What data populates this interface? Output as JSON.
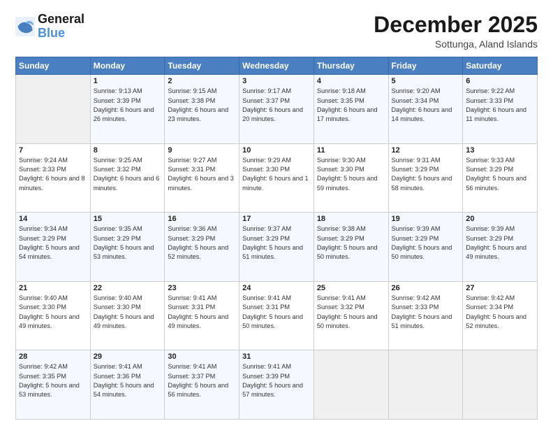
{
  "logo": {
    "line1": "General",
    "line2": "Blue"
  },
  "header": {
    "month": "December 2025",
    "location": "Sottunga, Aland Islands"
  },
  "weekdays": [
    "Sunday",
    "Monday",
    "Tuesday",
    "Wednesday",
    "Thursday",
    "Friday",
    "Saturday"
  ],
  "weeks": [
    [
      {
        "day": "",
        "info": ""
      },
      {
        "day": "1",
        "info": "Sunrise: 9:13 AM\nSunset: 3:39 PM\nDaylight: 6 hours\nand 26 minutes."
      },
      {
        "day": "2",
        "info": "Sunrise: 9:15 AM\nSunset: 3:38 PM\nDaylight: 6 hours\nand 23 minutes."
      },
      {
        "day": "3",
        "info": "Sunrise: 9:17 AM\nSunset: 3:37 PM\nDaylight: 6 hours\nand 20 minutes."
      },
      {
        "day": "4",
        "info": "Sunrise: 9:18 AM\nSunset: 3:35 PM\nDaylight: 6 hours\nand 17 minutes."
      },
      {
        "day": "5",
        "info": "Sunrise: 9:20 AM\nSunset: 3:34 PM\nDaylight: 6 hours\nand 14 minutes."
      },
      {
        "day": "6",
        "info": "Sunrise: 9:22 AM\nSunset: 3:33 PM\nDaylight: 6 hours\nand 11 minutes."
      }
    ],
    [
      {
        "day": "7",
        "info": "Sunrise: 9:24 AM\nSunset: 3:33 PM\nDaylight: 6 hours\nand 8 minutes."
      },
      {
        "day": "8",
        "info": "Sunrise: 9:25 AM\nSunset: 3:32 PM\nDaylight: 6 hours\nand 6 minutes."
      },
      {
        "day": "9",
        "info": "Sunrise: 9:27 AM\nSunset: 3:31 PM\nDaylight: 6 hours\nand 3 minutes."
      },
      {
        "day": "10",
        "info": "Sunrise: 9:29 AM\nSunset: 3:30 PM\nDaylight: 6 hours\nand 1 minute."
      },
      {
        "day": "11",
        "info": "Sunrise: 9:30 AM\nSunset: 3:30 PM\nDaylight: 5 hours\nand 59 minutes."
      },
      {
        "day": "12",
        "info": "Sunrise: 9:31 AM\nSunset: 3:29 PM\nDaylight: 5 hours\nand 58 minutes."
      },
      {
        "day": "13",
        "info": "Sunrise: 9:33 AM\nSunset: 3:29 PM\nDaylight: 5 hours\nand 56 minutes."
      }
    ],
    [
      {
        "day": "14",
        "info": "Sunrise: 9:34 AM\nSunset: 3:29 PM\nDaylight: 5 hours\nand 54 minutes."
      },
      {
        "day": "15",
        "info": "Sunrise: 9:35 AM\nSunset: 3:29 PM\nDaylight: 5 hours\nand 53 minutes."
      },
      {
        "day": "16",
        "info": "Sunrise: 9:36 AM\nSunset: 3:29 PM\nDaylight: 5 hours\nand 52 minutes."
      },
      {
        "day": "17",
        "info": "Sunrise: 9:37 AM\nSunset: 3:29 PM\nDaylight: 5 hours\nand 51 minutes."
      },
      {
        "day": "18",
        "info": "Sunrise: 9:38 AM\nSunset: 3:29 PM\nDaylight: 5 hours\nand 50 minutes."
      },
      {
        "day": "19",
        "info": "Sunrise: 9:39 AM\nSunset: 3:29 PM\nDaylight: 5 hours\nand 50 minutes."
      },
      {
        "day": "20",
        "info": "Sunrise: 9:39 AM\nSunset: 3:29 PM\nDaylight: 5 hours\nand 49 minutes."
      }
    ],
    [
      {
        "day": "21",
        "info": "Sunrise: 9:40 AM\nSunset: 3:30 PM\nDaylight: 5 hours\nand 49 minutes."
      },
      {
        "day": "22",
        "info": "Sunrise: 9:40 AM\nSunset: 3:30 PM\nDaylight: 5 hours\nand 49 minutes."
      },
      {
        "day": "23",
        "info": "Sunrise: 9:41 AM\nSunset: 3:31 PM\nDaylight: 5 hours\nand 49 minutes."
      },
      {
        "day": "24",
        "info": "Sunrise: 9:41 AM\nSunset: 3:31 PM\nDaylight: 5 hours\nand 50 minutes."
      },
      {
        "day": "25",
        "info": "Sunrise: 9:41 AM\nSunset: 3:32 PM\nDaylight: 5 hours\nand 50 minutes."
      },
      {
        "day": "26",
        "info": "Sunrise: 9:42 AM\nSunset: 3:33 PM\nDaylight: 5 hours\nand 51 minutes."
      },
      {
        "day": "27",
        "info": "Sunrise: 9:42 AM\nSunset: 3:34 PM\nDaylight: 5 hours\nand 52 minutes."
      }
    ],
    [
      {
        "day": "28",
        "info": "Sunrise: 9:42 AM\nSunset: 3:35 PM\nDaylight: 5 hours\nand 53 minutes."
      },
      {
        "day": "29",
        "info": "Sunrise: 9:41 AM\nSunset: 3:36 PM\nDaylight: 5 hours\nand 54 minutes."
      },
      {
        "day": "30",
        "info": "Sunrise: 9:41 AM\nSunset: 3:37 PM\nDaylight: 5 hours\nand 56 minutes."
      },
      {
        "day": "31",
        "info": "Sunrise: 9:41 AM\nSunset: 3:39 PM\nDaylight: 5 hours\nand 57 minutes."
      },
      {
        "day": "",
        "info": ""
      },
      {
        "day": "",
        "info": ""
      },
      {
        "day": "",
        "info": ""
      }
    ]
  ]
}
